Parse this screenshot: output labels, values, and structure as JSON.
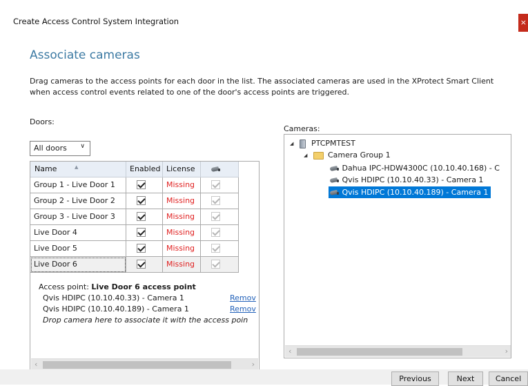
{
  "window": {
    "title": "Create Access Control System Integration",
    "close_glyph": "×"
  },
  "page": {
    "heading": "Associate cameras",
    "description": "Drag cameras to the access points for each door in the list. The associated cameras are used in the XProtect Smart Client when access control events related to one of the door's access points are triggered."
  },
  "doors": {
    "label": "Doors:",
    "filter": {
      "selected": "All doors"
    },
    "columns": {
      "name": "Name",
      "enabled": "Enabled",
      "license": "License",
      "camera_icon": "camera-icon"
    },
    "rows": [
      {
        "name": "Group 1 - Live Door 1",
        "enabled": true,
        "license": "Missing",
        "camera": true
      },
      {
        "name": "Group 2 - Live Door 2",
        "enabled": true,
        "license": "Missing",
        "camera": true
      },
      {
        "name": "Group 3 - Live Door 3",
        "enabled": true,
        "license": "Missing",
        "camera": true
      },
      {
        "name": "Live Door 4",
        "enabled": true,
        "license": "Missing",
        "camera": true
      },
      {
        "name": "Live Door 5",
        "enabled": true,
        "license": "Missing",
        "camera": true
      },
      {
        "name": "Live Door 6",
        "enabled": true,
        "license": "Missing",
        "camera": true
      }
    ],
    "access_point": {
      "prefix": "Access point:",
      "name": "Live Door 6 access point",
      "cameras": [
        {
          "name": "Qvis HDIPC (10.10.40.33) - Camera 1",
          "action": "Remov"
        },
        {
          "name": "Qvis HDIPC (10.10.40.189) - Camera 1",
          "action": "Remov"
        }
      ],
      "drop_hint": "Drop camera here to associate it with the access poin"
    }
  },
  "cameras": {
    "label": "Cameras:",
    "tree": {
      "server": "PTCPMTEST",
      "group": "Camera Group 1",
      "items": [
        "Dahua IPC-HDW4300C (10.10.40.168) - C",
        "Qvis HDIPC (10.10.40.33) - Camera 1",
        "Qvis HDIPC (10.10.40.189) - Camera 1"
      ]
    }
  },
  "footer": {
    "previous": "Previous",
    "next": "Next",
    "cancel": "Cancel"
  },
  "colors": {
    "heading": "#3c7aa3",
    "missing": "#e02020",
    "selection": "#0078d7",
    "link": "#1f5fb8"
  }
}
